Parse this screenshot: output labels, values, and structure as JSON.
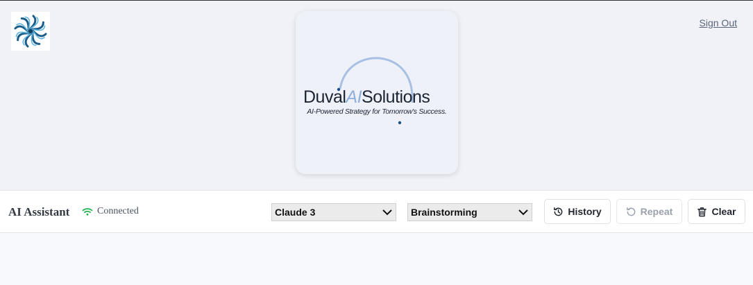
{
  "header": {
    "app_icon": "pinwheel-logo-icon",
    "sign_out_label": "Sign Out"
  },
  "logo": {
    "brand_part1": "Duval",
    "brand_ai": "AI",
    "brand_part2": "Solutions",
    "tagline": "AI-Powered Strategy for Tomorrow's Success."
  },
  "toolbar": {
    "title": "AI Assistant",
    "status_icon": "wifi-icon",
    "status": "Connected",
    "model_select": {
      "selected": "Claude 3"
    },
    "mode_select": {
      "selected": "Brainstorming"
    },
    "history_label": "History",
    "repeat_label": "Repeat",
    "clear_label": "Clear"
  },
  "colors": {
    "page_bg": "#f0f2f8",
    "connected_green": "#22b14c",
    "brand_dark": "#1c2431",
    "brand_ai_blue": "#8fb0dd",
    "disabled_text": "#9aa1ab"
  }
}
